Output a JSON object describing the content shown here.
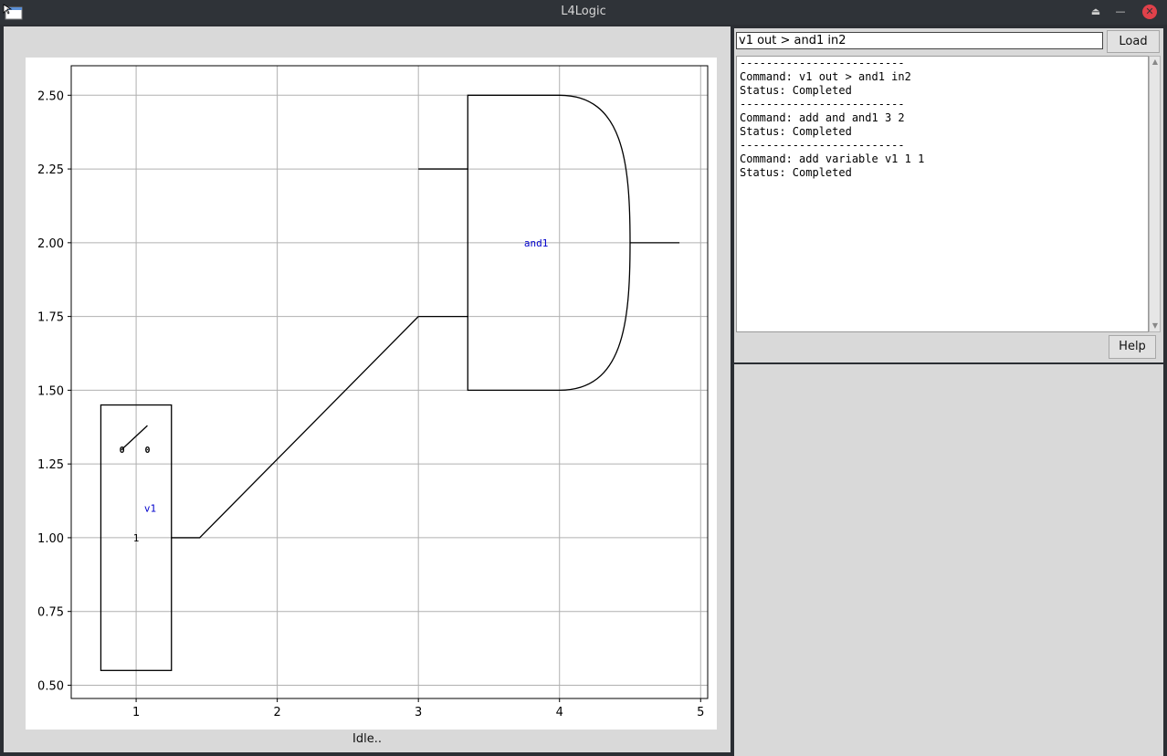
{
  "window": {
    "title": "L4Logic"
  },
  "command": {
    "value": "v1 out > and1 in2",
    "load_label": "Load",
    "help_label": "Help"
  },
  "log": [
    "-------------------------",
    "Command: v1 out > and1 in2",
    "Status: Completed",
    "-------------------------",
    "Command: add and and1 3 2",
    "Status: Completed",
    "-------------------------",
    "Command: add variable v1 1 1",
    "Status: Completed"
  ],
  "status": "Idle..",
  "plot": {
    "x_ticks": [
      "1",
      "2",
      "3",
      "4",
      "5"
    ],
    "y_ticks": [
      "0.50",
      "0.75",
      "1.00",
      "1.25",
      "1.50",
      "1.75",
      "2.00",
      "2.25",
      "2.50"
    ],
    "x_range": [
      0.54,
      5.05
    ],
    "y_range": [
      0.455,
      2.6
    ],
    "variable": {
      "name": "v1",
      "value": "1",
      "switch_labels": [
        "0",
        "0"
      ],
      "box": {
        "x": [
          0.75,
          1.25
        ],
        "y": [
          0.55,
          1.45
        ]
      },
      "output_y": 1.0
    },
    "gate": {
      "name": "and1",
      "type": "and",
      "body": {
        "x": [
          3.35,
          4.0
        ],
        "y": [
          1.5,
          2.5
        ]
      },
      "arc_tip_x": 4.5,
      "inputs_y": [
        2.25,
        1.75
      ],
      "input_x": 3.0,
      "output_x": 4.85,
      "output_y": 2.0
    },
    "wire": {
      "from": [
        1.25,
        1.0
      ],
      "via": [
        1.45,
        1.0
      ],
      "to": [
        3.0,
        1.75
      ]
    },
    "label_color": "#0000cc"
  }
}
